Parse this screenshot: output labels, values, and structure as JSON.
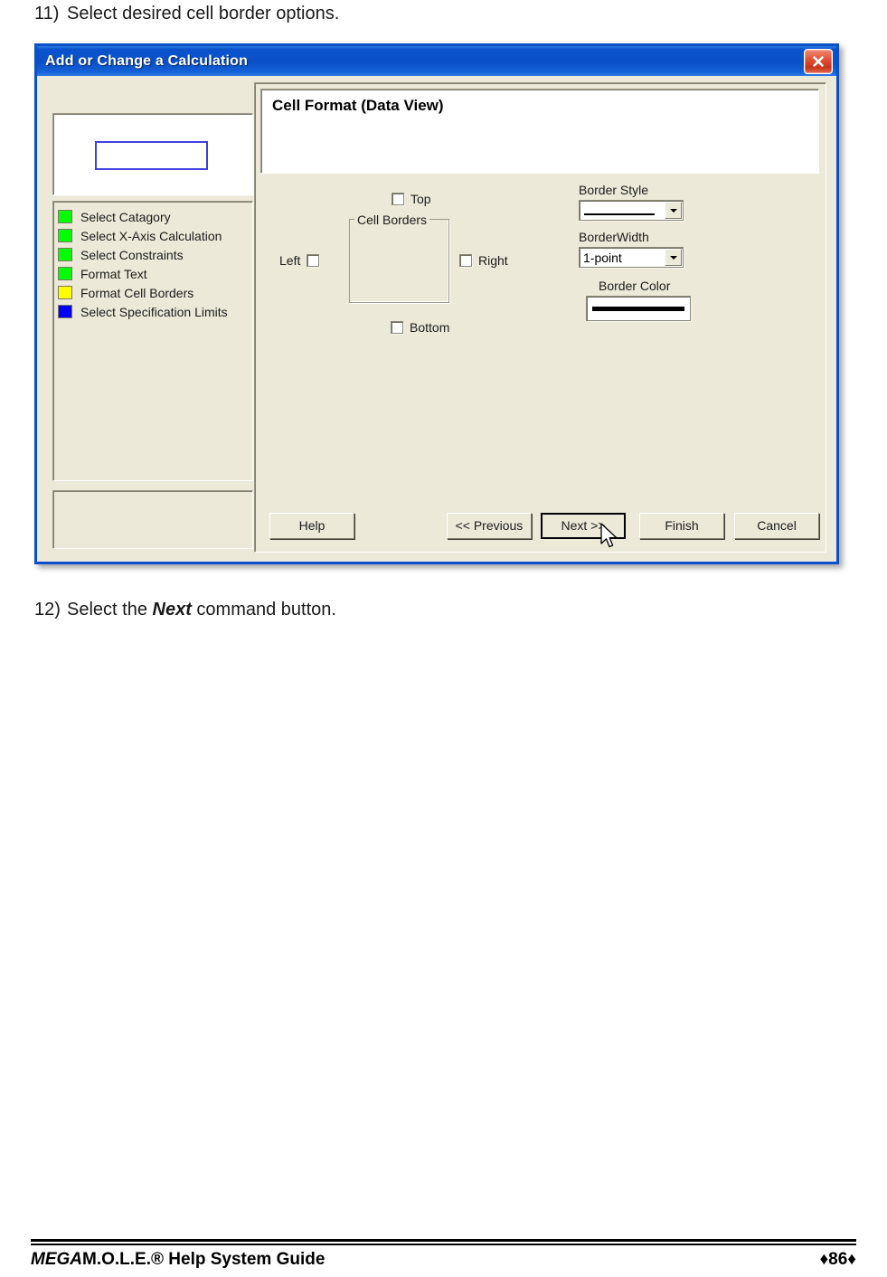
{
  "document": {
    "step_11": {
      "number": "11)",
      "text": "Select desired cell border options."
    },
    "step_12": {
      "number": "12)",
      "prefix": "Select the ",
      "emphasis": "Next",
      "suffix": " command button."
    }
  },
  "dialog": {
    "title": "Add or Change a Calculation",
    "close_icon": "close-icon",
    "header_title": "Cell Format (Data View)",
    "preview": {
      "cell_outline_color": "#4040e0"
    },
    "wizard_steps": [
      {
        "label": "Select Catagory",
        "color": "#00ff00"
      },
      {
        "label": "Select X-Axis Calculation",
        "color": "#00ff00"
      },
      {
        "label": "Select Constraints",
        "color": "#00ff00"
      },
      {
        "label": "Format Text",
        "color": "#00ff00"
      },
      {
        "label": "Format Cell Borders",
        "color": "#ffff00"
      },
      {
        "label": "Select Specification Limits",
        "color": "#0000ff"
      }
    ],
    "cell_borders": {
      "group_label": "Cell Borders",
      "checkboxes": [
        {
          "key": "top",
          "label": "Top",
          "checked": false
        },
        {
          "key": "bottom",
          "label": "Bottom",
          "checked": false
        },
        {
          "key": "left",
          "label": "Left",
          "checked": false
        },
        {
          "key": "right",
          "label": "Right",
          "checked": false
        }
      ]
    },
    "border_style": {
      "label": "Border Style",
      "value": ""
    },
    "border_width": {
      "label": "BorderWidth",
      "value": "1-point"
    },
    "border_color": {
      "label": "Border Color",
      "value": "#000000"
    },
    "buttons": {
      "help": "Help",
      "previous": "<< Previous",
      "next": "Next >>",
      "finish": "Finish",
      "cancel": "Cancel"
    },
    "colors": {
      "titlebar": "#0a50c8",
      "face": "#ece9d8",
      "close_button": "#c8331a"
    }
  },
  "footer": {
    "brand_emphasis": "MEGA",
    "brand_rest": "M.O.L.E.® Help System Guide",
    "page": "♦86♦"
  }
}
